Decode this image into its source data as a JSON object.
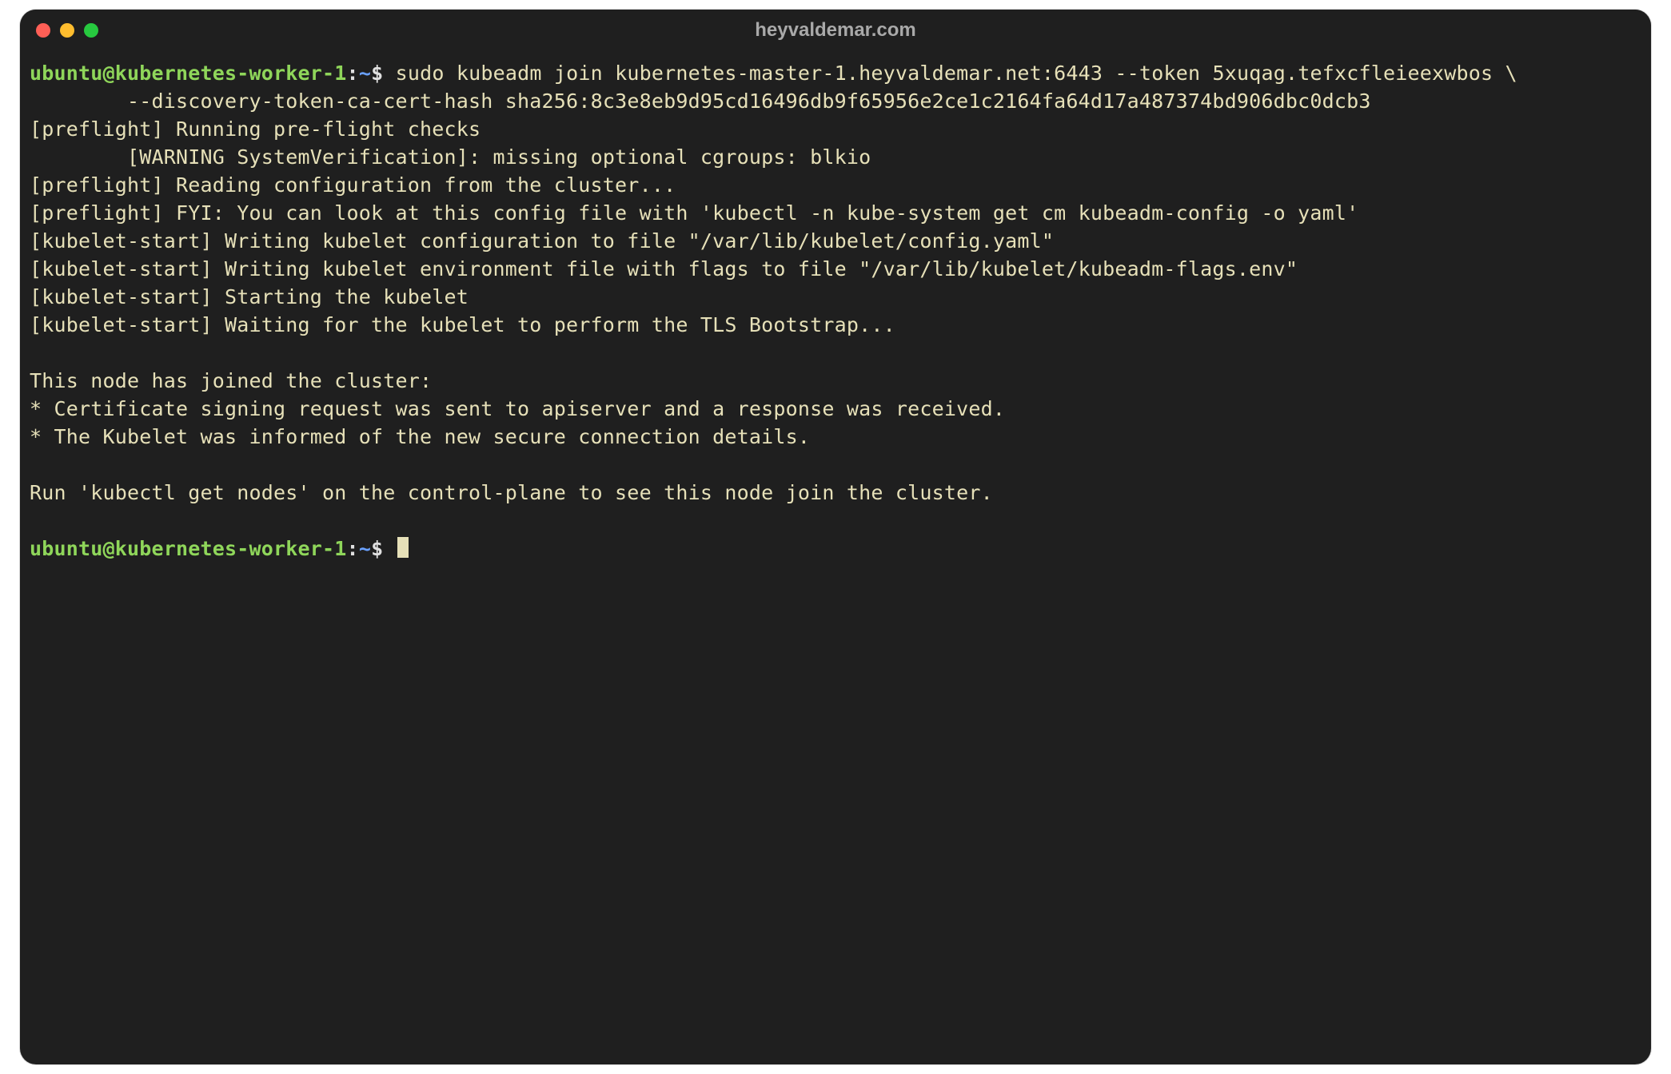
{
  "window": {
    "title": "heyvaldemar.com"
  },
  "prompt": {
    "user_host": "ubuntu@kubernetes-worker-1",
    "sep1": ":",
    "path": "~",
    "sigil": "$"
  },
  "command": {
    "line1": "sudo kubeadm join kubernetes-master-1.heyvaldemar.net:6443 --token 5xuqag.tefxcfleieexwbos \\",
    "line2": "        --discovery-token-ca-cert-hash sha256:8c3e8eb9d95cd16496db9f65956e2ce1c2164fa64d17a487374bd906dbc0dcb3"
  },
  "output": {
    "l1": "[preflight] Running pre-flight checks",
    "l2": "        [WARNING SystemVerification]: missing optional cgroups: blkio",
    "l3": "[preflight] Reading configuration from the cluster...",
    "l4": "[preflight] FYI: You can look at this config file with 'kubectl -n kube-system get cm kubeadm-config -o yaml'",
    "l5": "[kubelet-start] Writing kubelet configuration to file \"/var/lib/kubelet/config.yaml\"",
    "l6": "[kubelet-start] Writing kubelet environment file with flags to file \"/var/lib/kubelet/kubeadm-flags.env\"",
    "l7": "[kubelet-start] Starting the kubelet",
    "l8": "[kubelet-start] Waiting for the kubelet to perform the TLS Bootstrap...",
    "l9": "",
    "l10": "This node has joined the cluster:",
    "l11": "* Certificate signing request was sent to apiserver and a response was received.",
    "l12": "* The Kubelet was informed of the new secure connection details.",
    "l13": "",
    "l14": "Run 'kubectl get nodes' on the control-plane to see this node join the cluster.",
    "l15": ""
  }
}
